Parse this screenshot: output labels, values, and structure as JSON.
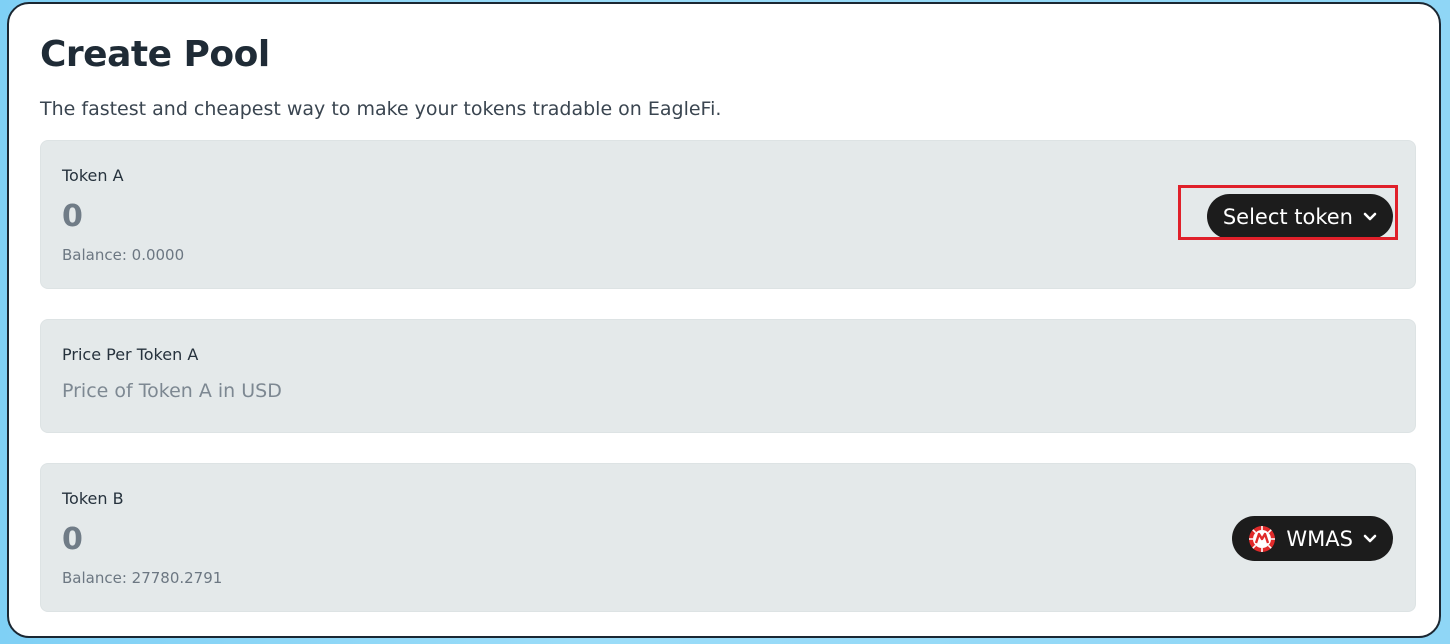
{
  "page": {
    "title": "Create Pool",
    "subtitle": "The fastest and cheapest way to make your tokens tradable on EagleFi."
  },
  "token_a": {
    "label": "Token A",
    "amount": "0",
    "balance": "Balance: 0.0000",
    "select_button_label": "Select token",
    "highlighted": true
  },
  "price_per_token_a": {
    "label": "Price Per Token A",
    "placeholder": "Price of Token A in USD",
    "value": ""
  },
  "token_b": {
    "label": "Token B",
    "amount": "0",
    "balance": "Balance: 27780.2791",
    "selected_token": "WMAS",
    "token_icon": "wmas-coin-icon"
  },
  "colors": {
    "highlight": "#e0202a",
    "button_bg": "#1c1c1c",
    "panel_bg": "#e4e9ea",
    "wmas_icon": "#e02a2a"
  }
}
